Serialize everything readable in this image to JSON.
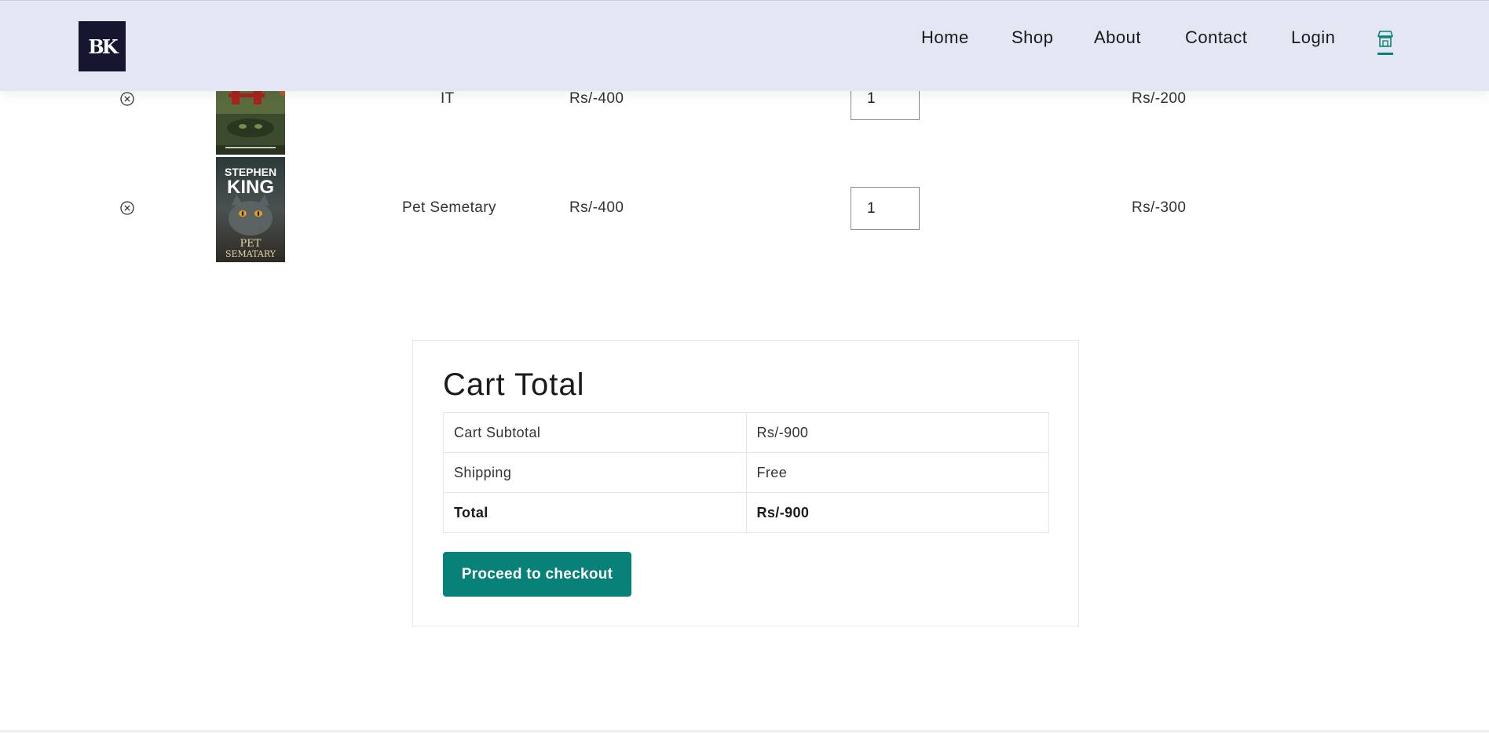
{
  "header": {
    "logo_text": "BK",
    "nav": [
      {
        "label": "Home"
      },
      {
        "label": "Shop"
      },
      {
        "label": "About"
      },
      {
        "label": "Contact"
      },
      {
        "label": "Login"
      }
    ],
    "cart_icon": "shop-bag-icon",
    "accent_color": "#088178",
    "background_color": "#e3e6f3"
  },
  "cart": {
    "items": [
      {
        "remove_icon": "remove-circle-icon",
        "image_icon": "book-cover-it",
        "product": "IT",
        "price": "Rs/-400",
        "quantity": "1",
        "subtotal": "Rs/-200"
      },
      {
        "remove_icon": "remove-circle-icon",
        "image_icon": "book-cover-pet-sematary",
        "product": "Pet Semetary",
        "price": "Rs/-400",
        "quantity": "1",
        "subtotal": "Rs/-300"
      }
    ]
  },
  "cart_total": {
    "title": "Cart Total",
    "rows": [
      {
        "label": "Cart Subtotal",
        "value": "Rs/-900"
      },
      {
        "label": "Shipping",
        "value": "Free"
      },
      {
        "label": "Total",
        "value": "Rs/-900"
      }
    ],
    "checkout_label": "Proceed to checkout",
    "button_color": "#088178"
  },
  "book_covers": {
    "pet_sematary": {
      "author_line_1": "STEPHEN",
      "author_line_2": "KING",
      "title_line_1": "PET",
      "title_line_2": "SEMATARY"
    }
  }
}
